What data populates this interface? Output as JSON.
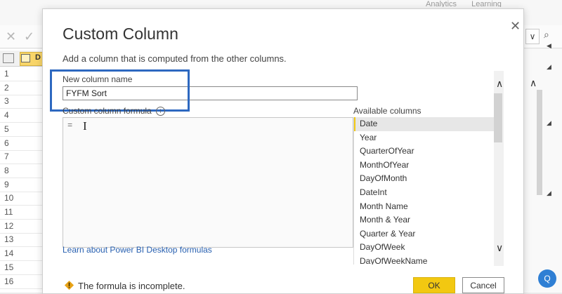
{
  "background": {
    "top_tabs": [
      "Analytics",
      "Learning"
    ],
    "grid_column_header": "D",
    "row_numbers": [
      "1",
      "2",
      "3",
      "4",
      "5",
      "6",
      "7",
      "8",
      "9",
      "10",
      "11",
      "12",
      "13",
      "14",
      "15",
      "16"
    ],
    "watermark": "Q"
  },
  "dialog": {
    "title": "Custom Column",
    "subtitle": "Add a column that is computed from the other columns.",
    "name_label": "New column name",
    "name_value": "FYFM Sort",
    "formula_label": "Custom column formula",
    "formula_value": "=",
    "learn_link": "Learn about Power BI Desktop formulas",
    "available_label": "Available columns",
    "available_columns": [
      "Date",
      "Year",
      "QuarterOfYear",
      "MonthOfYear",
      "DayOfMonth",
      "DateInt",
      "Month Name",
      "Month & Year",
      "Quarter & Year",
      "DayOfWeek",
      "DayOfWeekName"
    ],
    "selected_column": "Date",
    "warning": "The formula is incomplete.",
    "ok_label": "OK",
    "cancel_label": "Cancel"
  },
  "colors": {
    "accent": "#f2c811",
    "highlight_border": "#2d68c0",
    "link": "#2860b0"
  }
}
